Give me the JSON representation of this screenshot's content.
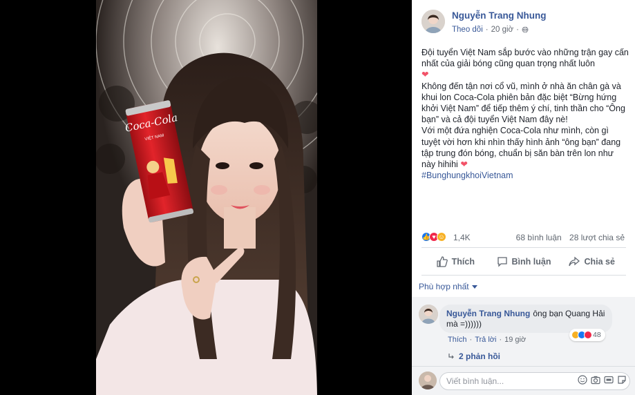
{
  "post": {
    "author": "Nguyễn Trang Nhung",
    "follow_label": "Theo dõi",
    "time": "20 giờ",
    "paragraphs": [
      "Đội tuyển Việt Nam sắp bước vào những trận gay cấn nhất của giải bóng cũng quan trọng nhất luôn",
      "Không đến tận nơi cổ vũ, mình ở nhà ăn chân gà và khui lon Coca-Cola phiên bản đặc biệt “Bừng hứng khởi Việt Nam” để tiếp thêm ý chí, tinh thần cho “Ông bạn” và cả đội tuyển Việt Nam đây nè!",
      "Với một đứa nghiện Coca-Cola như mình, còn gì tuyệt vời hơn khi nhìn thấy hình ảnh “ông bạn” đang tập trung đón bóng, chuẩn bị săn bàn trên lon như này hihihi"
    ],
    "hashtag": "#BunghungkhoiVietnam",
    "heart": "❤"
  },
  "reactions": {
    "count": "1,4K",
    "comments": "68 bình luận",
    "shares": "28 lượt chia sẻ"
  },
  "actions": {
    "like": "Thích",
    "comment": "Bình luận",
    "share": "Chia sẻ"
  },
  "sort": {
    "label": "Phù hợp nhất"
  },
  "comment": {
    "author": "Nguyễn Trang Nhung",
    "text": "ông bạn Quang Hải mà =))))))",
    "like": "Thích",
    "reply": "Trả lời",
    "time": "19 giờ",
    "reaction_count": "48",
    "replies": "2 phản hồi"
  },
  "composer": {
    "placeholder": "Viết bình luận..."
  },
  "can": {
    "brand": "Coca-Cola",
    "edition": "VIỆT NAM"
  },
  "colors": {
    "link": "#385898",
    "like": "#1877f2",
    "love": "#f0284a",
    "haha": "#f7b125",
    "can_red": "#d4171e"
  }
}
